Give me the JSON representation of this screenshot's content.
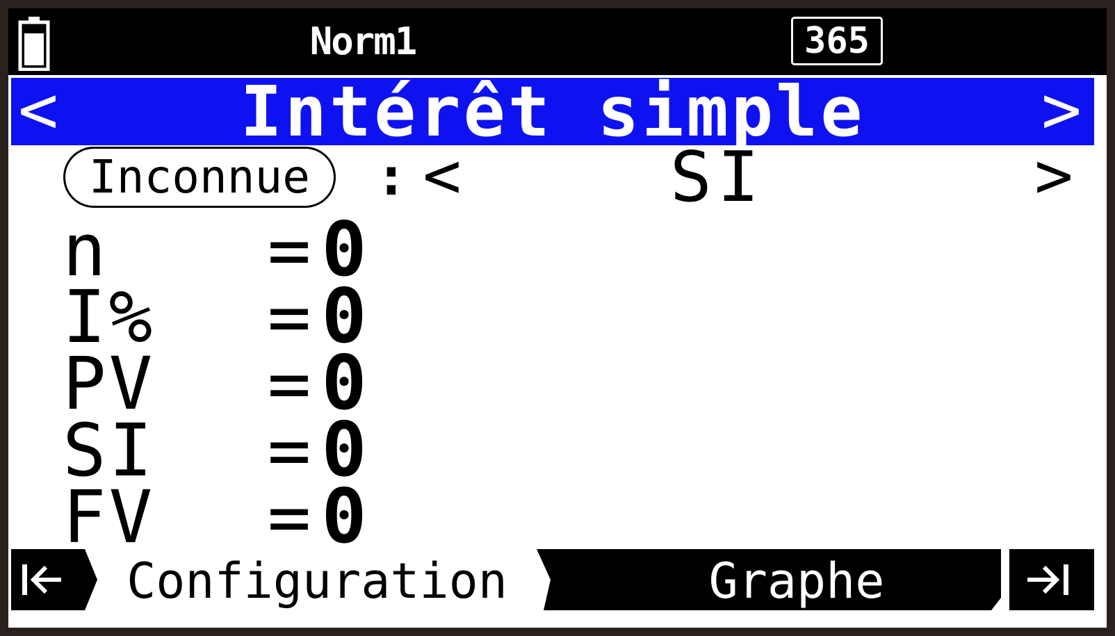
{
  "status_bar": {
    "mode": "Norm1",
    "days_per_year": "365",
    "battery_icon": "battery-icon"
  },
  "title_bar": {
    "title": "Intérêt simple",
    "prev_glyph": "<",
    "next_glyph": ">"
  },
  "unknown_selector": {
    "label": "Inconnue",
    "separator": ":",
    "value": "SI",
    "prev_glyph": "<",
    "next_glyph": ">"
  },
  "variables": [
    {
      "name": "n",
      "eq": "=",
      "value": "0"
    },
    {
      "name": "I%",
      "eq": "=",
      "value": "0"
    },
    {
      "name": "PV",
      "eq": "=",
      "value": "0"
    },
    {
      "name": "SI",
      "eq": "=",
      "value": "0"
    },
    {
      "name": "FV",
      "eq": "=",
      "value": "0"
    }
  ],
  "function_bar": {
    "first_icon": "jump-to-first-icon",
    "tabs": [
      {
        "label": "Configuration",
        "active": true
      },
      {
        "label": "Graphe",
        "active": false
      }
    ],
    "last_icon": "jump-to-last-icon"
  },
  "colors": {
    "title_background": "#0f12f0",
    "bar_background": "#000000",
    "screen_background": "#ffffff",
    "bezel": "#2b2220"
  }
}
